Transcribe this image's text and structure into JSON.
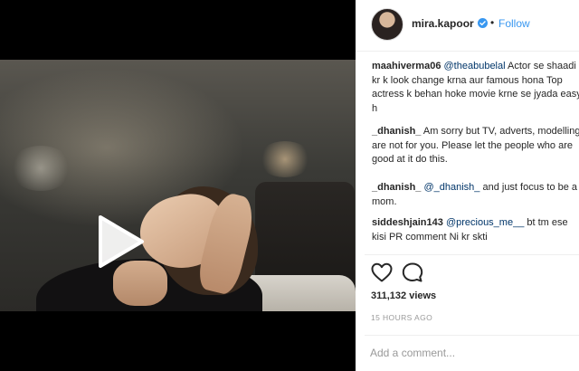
{
  "header": {
    "username": "mira.kapoor",
    "verified_icon": "verified-badge-icon",
    "separator": "•",
    "follow_label": "Follow"
  },
  "media": {
    "type": "video",
    "play_icon": "play-icon"
  },
  "comments": [
    {
      "user": "maahiverma06",
      "mention": "@theabubelal",
      "text": " Actor se shaadi kr k look change krna aur famous hona Top actress k behan hoke movie krne se jyada easy h"
    },
    {
      "user": "_dhanish_",
      "mention": "",
      "text": " Am sorry but TV, adverts, modelling are not for you. Please let the people who are good at it do this."
    },
    {
      "user": "_dhanish_",
      "mention": "@_dhanish_",
      "text": " and just focus to be a mom."
    },
    {
      "user": "siddeshjain143",
      "mention": "@precious_me__",
      "text": " bt tm ese kisi PR comment Ni kr skti"
    }
  ],
  "actions": {
    "like_icon": "heart-icon",
    "comment_icon": "comment-icon"
  },
  "views": "311,132 views",
  "timestamp": "15 HOURS AGO",
  "comment_box": {
    "placeholder": "Add a comment..."
  },
  "colors": {
    "accent": "#3897f0",
    "mention": "#003569",
    "muted": "#999999"
  }
}
